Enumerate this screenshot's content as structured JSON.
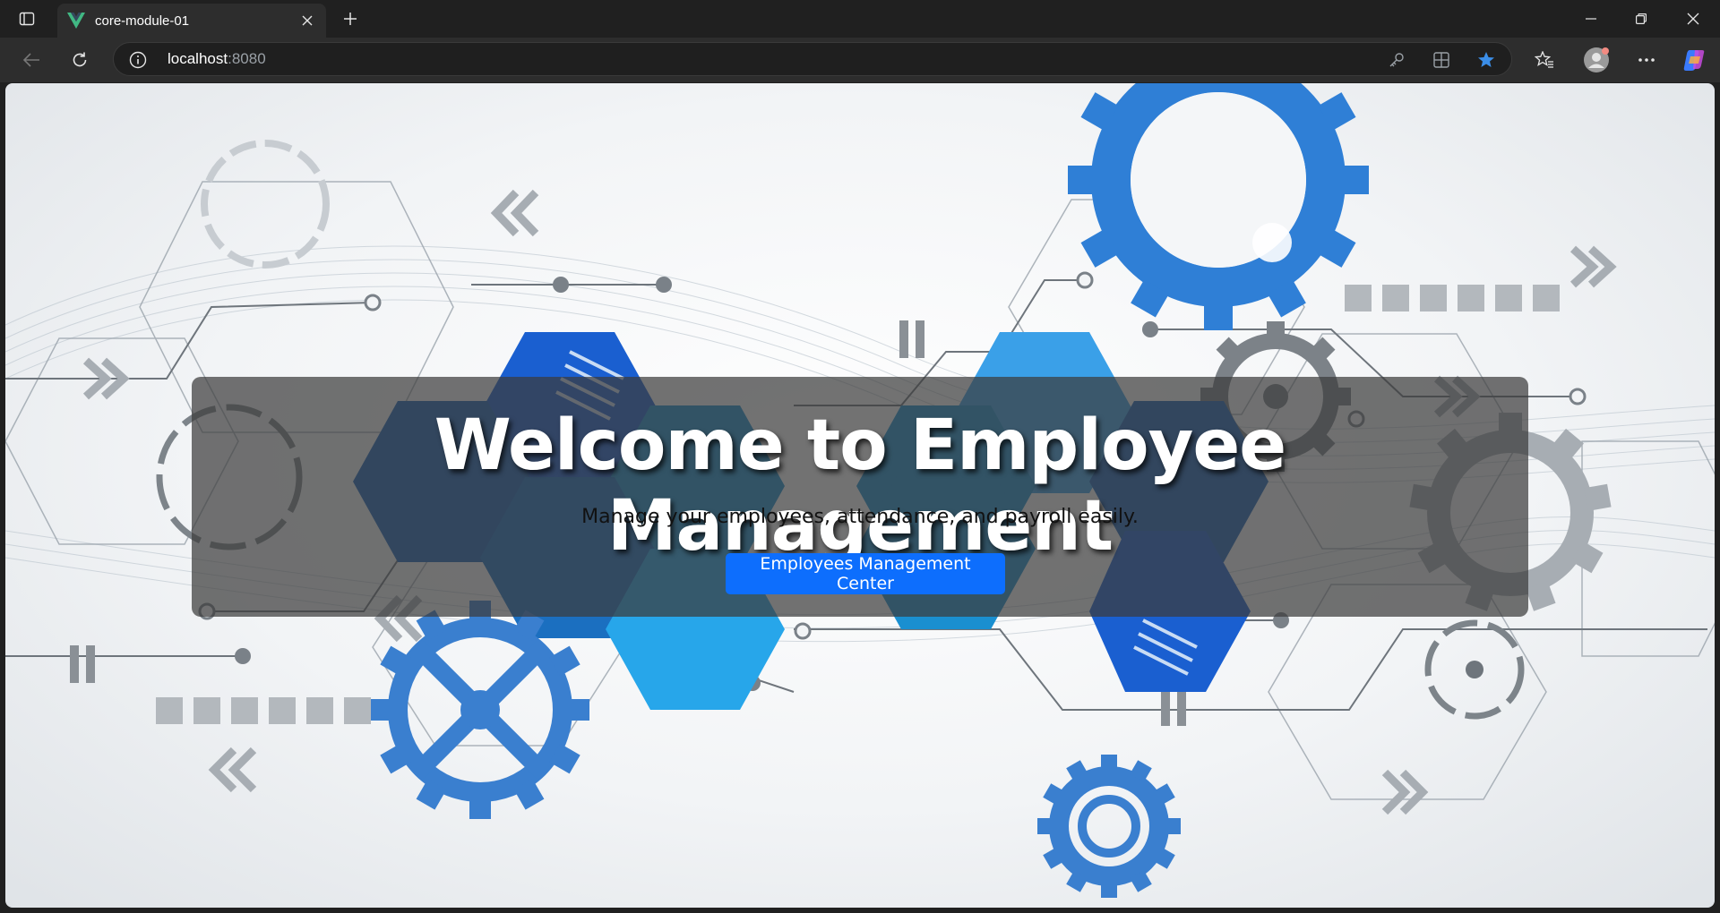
{
  "browser": {
    "tab": {
      "title": "core-module-01",
      "favicon": "vue-logo-icon"
    },
    "address": {
      "host": "localhost",
      "port": ":8080"
    },
    "icons": {
      "sidebar": "tab-actions-icon",
      "close_tab": "close-icon",
      "new_tab": "plus-icon",
      "back": "back-arrow-icon",
      "reload": "reload-icon",
      "site_info": "info-icon",
      "password": "key-icon",
      "apps": "apps-icon",
      "favorite": "star-icon",
      "favorites": "favorites-icon",
      "profile": "avatar",
      "more": "more-icon",
      "copilot": "copilot-icon",
      "minimize": "minimize-icon",
      "restore": "restore-icon",
      "close_window": "close-window-icon"
    }
  },
  "hero": {
    "title": "Welcome to Employee Management",
    "subtitle": "Manage your employees, attendance, and payroll easily.",
    "button_label": "Employees Management Center"
  },
  "colors": {
    "primary_button": "#0d6efd",
    "hero_overlay": "rgba(60,60,60,0.72)",
    "gear_blue": "#2f7fd6",
    "hex_blue": "#1a7fd0"
  }
}
